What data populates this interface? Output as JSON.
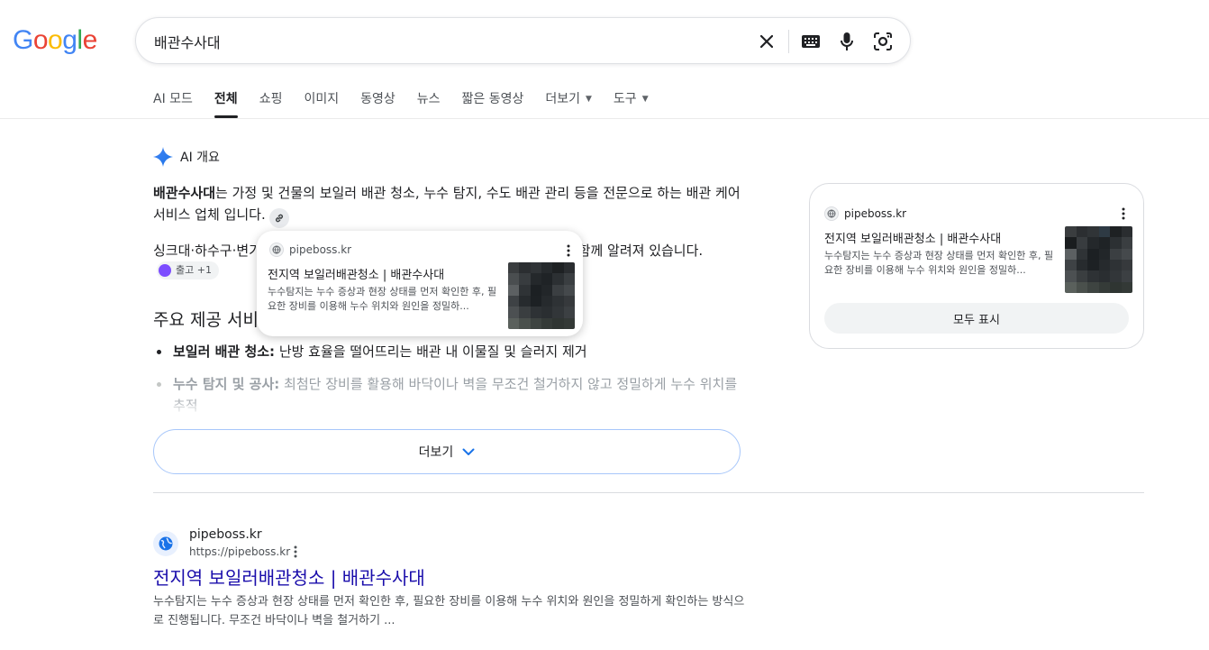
{
  "logo": {
    "letters": [
      "G",
      "o",
      "o",
      "g",
      "l",
      "e"
    ],
    "colors": [
      "#4285F4",
      "#EA4335",
      "#FBBC05",
      "#4285F4",
      "#34A853",
      "#EA4335"
    ]
  },
  "search": {
    "query": "배관수사대"
  },
  "tabs": [
    {
      "label": "AI 모드"
    },
    {
      "label": "전체"
    },
    {
      "label": "쇼핑"
    },
    {
      "label": "이미지"
    },
    {
      "label": "동영상"
    },
    {
      "label": "뉴스"
    },
    {
      "label": "짧은 동영상"
    },
    {
      "label": "더보기"
    },
    {
      "label": "도구"
    }
  ],
  "ai_overview": {
    "heading": "AI 개요",
    "para1_bold": "배관수사대",
    "para1_rest": "는 가정 및 건물의 보일러 배관 청소, 누수 탐지, 수도 배관 관리 등을 전문으로 하는 배관 케어 서비스 업체",
    "para1_end": "입니다.",
    "para2_start": "싱크대·하수구·변기",
    "para2_end": "어 업체도 함께 알려져 있습니다.",
    "ref_chip": "출고 +1",
    "subheading": "주요 제공 서비스",
    "list": [
      {
        "bold": "보일러 배관 청소:",
        "text": " 난방 효율을 떨어뜨리는 배관 내 이물질 및 슬러지 제거"
      },
      {
        "bold": "누수 탐지 및 공사:",
        "text": " 최첨단 장비를 활용해 바닥이나 벽을 무조건 철거하지 않고 정밀하게 누수 위치를 추적"
      }
    ],
    "more_label": "더보기"
  },
  "popup_card": {
    "site": "pipeboss.kr",
    "title": "전지역 보일러배관청소 | 배관수사대",
    "desc": "누수탐지는 누수 증상과 현장 상태를 먼저 확인한 후, 필요한 장비를 이용해 누수 위치와 원인을 정밀하..."
  },
  "source_panel": {
    "site": "pipeboss.kr",
    "title": "전지역 보일러배관청소 | 배관수사대",
    "desc": "누수탐지는 누수 증상과 현장 상태를 먼저 확인한 후, 필요한 장비를 이용해 누수 위치와 원인을 정밀하...",
    "show_all": "모두 표시"
  },
  "result": {
    "site_name": "pipeboss.kr",
    "url": "https://pipeboss.kr",
    "title": "전지역 보일러배관청소 | 배관수사대",
    "snippet": "누수탐지는 누수 증상과 현장 상태를 먼저 확인한 후, 필요한 장비를 이용해 누수 위치와 원인을 정밀하게 확인하는 방식으로 진행됩니다. 무조건 바닥이나 벽을 철거하기 ..."
  },
  "colors": {
    "link": "#1a0dab",
    "accent_blue": "#4285F4",
    "border": "#dadce0"
  }
}
